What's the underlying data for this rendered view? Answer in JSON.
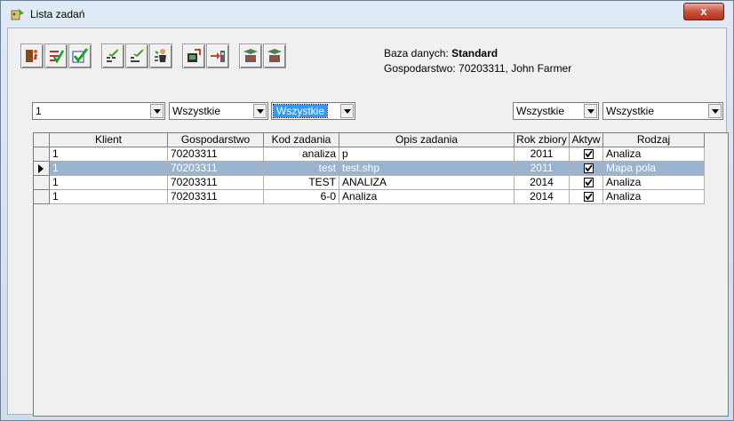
{
  "window": {
    "title": "Lista zadań",
    "close_label": "x"
  },
  "info": {
    "db_label": "Baza danych: ",
    "db_value": "Standard",
    "farm_line": "Gospodarstwo: 70203311, John Farmer"
  },
  "toolbar": {
    "icons": [
      "exit-icon",
      "check-list-icon",
      "checkmark-icon",
      "edit-list-icon",
      "edit-list-2-icon",
      "person-list-icon",
      "import-icon",
      "export-icon",
      "map-import-icon",
      "map-export-icon"
    ]
  },
  "filters": {
    "client": "1",
    "filter2": "Wszystkie",
    "filter3": "Wszystkie",
    "filter4": "Wszystkie",
    "filter5": "Wszystkie"
  },
  "table": {
    "columns": [
      "Klient",
      "Gospodarstwo",
      "Kod zadania",
      "Opis zadania",
      "Rok zbiory",
      "Aktyw",
      "Rodzaj"
    ],
    "rows": [
      {
        "klient": "1",
        "gosp": "70203311",
        "kod": "analiza",
        "opis": "p",
        "rok": "2011",
        "aktyw": true,
        "rodzaj": "Analiza"
      },
      {
        "klient": "1",
        "gosp": "70203311",
        "kod": "test",
        "opis": "test.shp",
        "rok": "2011",
        "aktyw": true,
        "rodzaj": "Mapa pola"
      },
      {
        "klient": "1",
        "gosp": "70203311",
        "kod": "TEST",
        "opis": "ANALIZA",
        "rok": "2014",
        "aktyw": true,
        "rodzaj": "Analiza"
      },
      {
        "klient": "1",
        "gosp": "70203311",
        "kod": "6-0",
        "opis": "Analiza",
        "rok": "2014",
        "aktyw": true,
        "rodzaj": "Analiza"
      }
    ]
  }
}
